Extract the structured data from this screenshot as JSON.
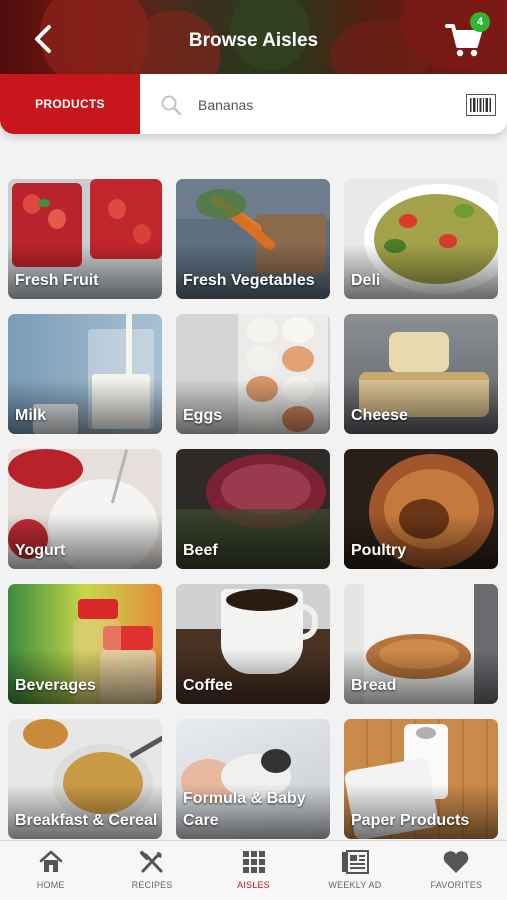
{
  "header": {
    "title": "Browse Aisles",
    "cart_count": "4",
    "back_icon": "chevron-left-icon",
    "cart_icon": "shopping-cart-icon"
  },
  "search": {
    "tab_label": "PRODUCTS",
    "value": "Bananas",
    "icon": "search-icon",
    "barcode_icon": "barcode-icon"
  },
  "aisles": [
    {
      "label": "Fresh Fruit"
    },
    {
      "label": "Fresh Vegetables"
    },
    {
      "label": "Deli"
    },
    {
      "label": "Milk"
    },
    {
      "label": "Eggs"
    },
    {
      "label": "Cheese"
    },
    {
      "label": "Yogurt"
    },
    {
      "label": "Beef"
    },
    {
      "label": "Poultry"
    },
    {
      "label": "Beverages"
    },
    {
      "label": "Coffee"
    },
    {
      "label": "Bread"
    },
    {
      "label": "Breakfast & Cereal"
    },
    {
      "label": "Formula & Baby Care"
    },
    {
      "label": "Paper Products"
    }
  ],
  "bottom_nav": [
    {
      "label": "HOME",
      "icon": "home-icon",
      "active": false
    },
    {
      "label": "RECIPES",
      "icon": "fork-knife-icon",
      "active": false
    },
    {
      "label": "AISLES",
      "icon": "grid-icon",
      "active": true
    },
    {
      "label": "WEEKLY AD",
      "icon": "newspaper-icon",
      "active": false
    },
    {
      "label": "FAVORITES",
      "icon": "heart-icon",
      "active": false
    }
  ],
  "colors": {
    "accent": "#c8161d",
    "badge": "#2fb52f"
  }
}
